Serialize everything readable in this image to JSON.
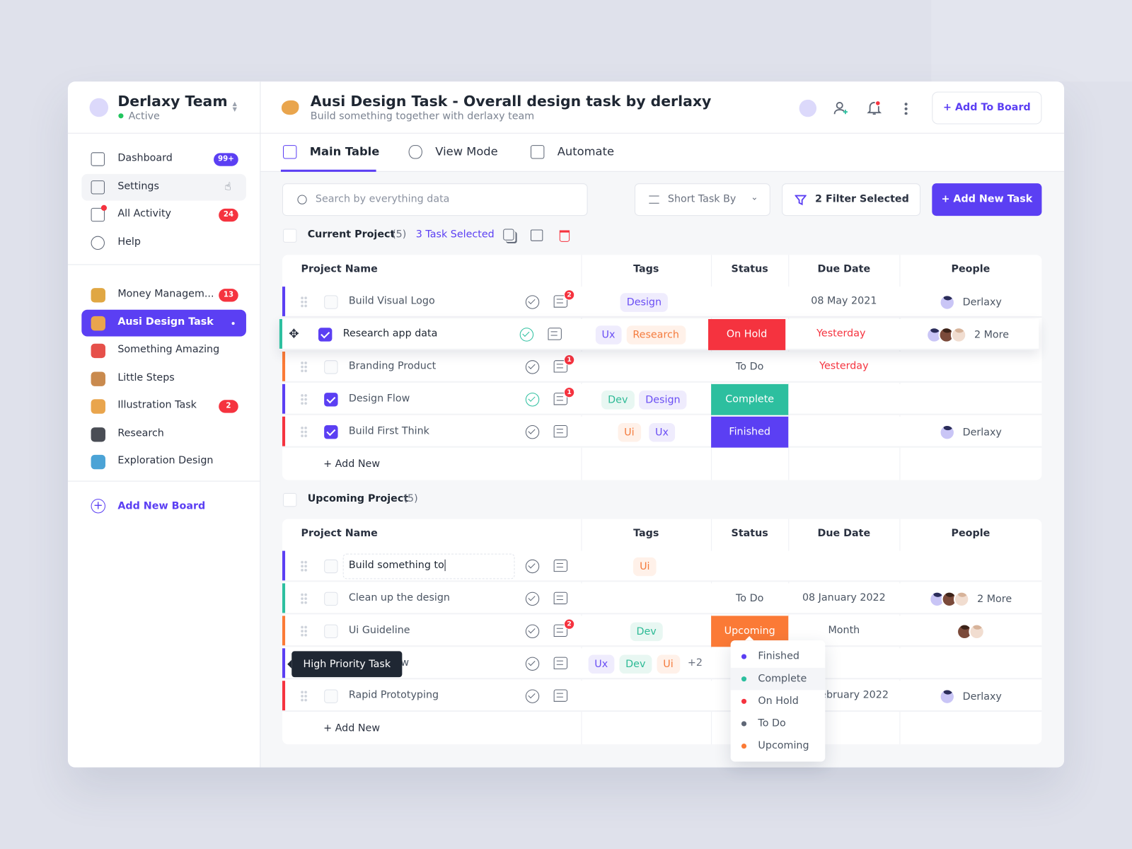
{
  "colors": {
    "accent": "#5b3ff3",
    "danger": "#f5333f",
    "success": "#2dbf9f",
    "warning": "#fb7a36"
  },
  "team": {
    "name": "Derlaxy Team",
    "status": "Active"
  },
  "nav": [
    {
      "label": "Dashboard",
      "badge": "99+",
      "icon": "dashboard-icon"
    },
    {
      "label": "Settings",
      "icon": "gear-icon"
    },
    {
      "label": "All Activity",
      "badge": "24",
      "icon": "activity-icon"
    },
    {
      "label": "Help",
      "icon": "info-icon"
    }
  ],
  "boards": [
    {
      "label": "Money Managem...",
      "badge": "13",
      "color": "#e0a743"
    },
    {
      "label": "Ausi Design Task",
      "active": true,
      "color": "#e9a54d"
    },
    {
      "label": "Something Amazing",
      "color": "#e6504a"
    },
    {
      "label": "Little Steps",
      "color": "#c98a4e"
    },
    {
      "label": "Illustration Task",
      "badge": "2",
      "color": "#e9a54d"
    },
    {
      "label": "Research",
      "color": "#4a4d55"
    },
    {
      "label": "Exploration Design",
      "color": "#4ba3d6"
    }
  ],
  "add_board": "Add New Board",
  "header": {
    "title": "Ausi Design Task - Overall design task by derlaxy",
    "subtitle": "Build something together with derlaxy team",
    "add_to_board": "+ Add To Board"
  },
  "tabs": [
    {
      "label": "Main Table",
      "active": true
    },
    {
      "label": "View Mode"
    },
    {
      "label": "Automate"
    }
  ],
  "toolbar": {
    "search_placeholder": "Search by everything data",
    "sort_label": "Short Task By",
    "filter_label": "2 Filter Selected",
    "add_task": "+ Add New Task"
  },
  "columns": [
    "Project Name",
    "Tags",
    "Status",
    "Due Date",
    "People"
  ],
  "sections": [
    {
      "title": "Current Project",
      "count": "(5)",
      "selected": "3 Task Selected",
      "add_new": "+ Add New",
      "rows": [
        {
          "name": "Build Visual Logo",
          "stripe": "#5b3ff3",
          "checked": false,
          "done": false,
          "comments": "2",
          "tags": [
            "Design"
          ],
          "status": "",
          "due": "08 May 2021",
          "due_red": false,
          "people": [
            "a1"
          ],
          "people_text": "Derlaxy"
        },
        {
          "name": "Research app data",
          "stripe": "#2dbf9f",
          "checked": true,
          "done": true,
          "lifted": true,
          "tags": [
            "Ux",
            "Research"
          ],
          "status": "On Hold",
          "due": "Yesterday",
          "due_red": true,
          "people": [
            "a1",
            "a2",
            "a3"
          ],
          "people_text": "2 More"
        },
        {
          "name": "Branding Product",
          "stripe": "#fb7a36",
          "checked": false,
          "done": false,
          "comments": "1",
          "tags": [],
          "status": "To Do",
          "due": "Yesterday",
          "due_red": true,
          "people": [],
          "people_text": ""
        },
        {
          "name": "Design Flow",
          "stripe": "#5b3ff3",
          "checked": true,
          "done": true,
          "comments": "1",
          "tags": [
            "Dev",
            "Design"
          ],
          "status": "Complete",
          "due": "",
          "people": [],
          "people_text": ""
        },
        {
          "name": "Build First Think",
          "stripe": "#f5333f",
          "checked": true,
          "done": false,
          "tags": [
            "Ui",
            "Ux"
          ],
          "status": "Finished",
          "due": "",
          "people": [
            "a1"
          ],
          "people_text": "Derlaxy"
        }
      ]
    },
    {
      "title": "Upcoming Project",
      "count": "(5)",
      "add_new": "+ Add New",
      "rows": [
        {
          "name": "Build something to",
          "stripe": "#5b3ff3",
          "editing": true,
          "checked": false,
          "done": false,
          "tags": [
            "Ui"
          ],
          "status": "",
          "due": "",
          "people": [],
          "people_text": ""
        },
        {
          "name": "Clean up the design",
          "stripe": "#2dbf9f",
          "checked": false,
          "done": false,
          "tags": [],
          "status": "To Do",
          "due": "08 January 2022",
          "people": [
            "a1",
            "a2",
            "a3"
          ],
          "people_text": "2 More"
        },
        {
          "name": "Ui Guideline",
          "stripe": "#fb7a36",
          "checked": false,
          "done": false,
          "comments": "2",
          "tags": [
            "Dev"
          ],
          "status": "Upcoming",
          "due": "Month",
          "people": [
            "a2",
            "a3"
          ],
          "people_text": ""
        },
        {
          "name": "w",
          "stripe": "#5b3ff3",
          "checked": false,
          "done": false,
          "tags": [
            "Ux",
            "Dev",
            "Ui"
          ],
          "more_tags": "+2",
          "status": "",
          "due": "",
          "people": [],
          "people_text": ""
        },
        {
          "name": "Rapid Prototyping",
          "stripe": "#f5333f",
          "checked": false,
          "done": false,
          "tags": [],
          "status": "",
          "due": "ebruary 2022",
          "people": [
            "a1"
          ],
          "people_text": "Derlaxy"
        }
      ]
    }
  ],
  "tooltip": "High Priority Task",
  "status_menu": [
    {
      "label": "Finished",
      "color": "#5b3ff3"
    },
    {
      "label": "Complete",
      "color": "#2dbf9f",
      "hover": true
    },
    {
      "label": "On Hold",
      "color": "#f5333f"
    },
    {
      "label": "To Do",
      "color": "#5f6776"
    },
    {
      "label": "Upcoming",
      "color": "#fb7a36"
    }
  ]
}
